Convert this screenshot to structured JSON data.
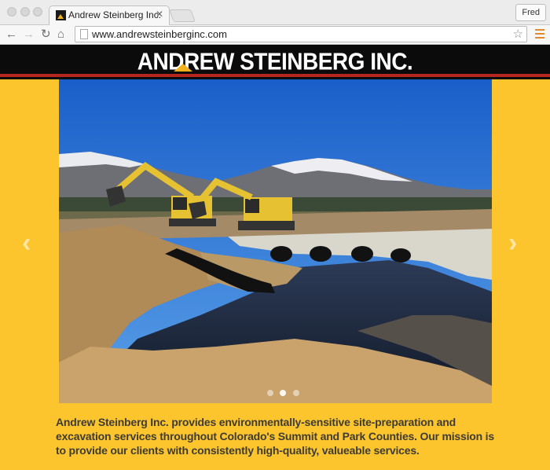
{
  "browser": {
    "tab_title": "Andrew Steinberg Inc.",
    "tab_close": "✕",
    "profile_name": "Fred",
    "url": "www.andrewsteinberginc.com",
    "back_icon": "←",
    "forward_icon": "→",
    "reload_icon": "↻",
    "home_icon": "⌂",
    "star_icon": "☆"
  },
  "site": {
    "logo_text": "ANDREW STEINBERG INC.",
    "prev_arrow": "‹",
    "next_arrow": "›",
    "slider": {
      "slide_count": 3,
      "active_index": 1
    },
    "description": "Andrew Steinberg Inc. provides environmentally-sensitive site-preparation and excavation services throughout Colorado's Summit and Park Counties. Our mission is to provide our clients with consistently high-quality, valueable services."
  },
  "colors": {
    "page_background": "#fcc52e",
    "header_background": "#0b0b0b",
    "header_stripe": "#b5261e",
    "logo_accent": "#f2b01e",
    "body_text": "#3e3b35"
  }
}
